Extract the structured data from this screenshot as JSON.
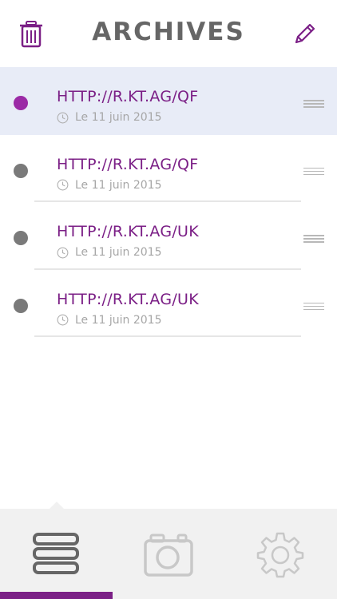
{
  "header": {
    "title": "ARCHIVES",
    "trash_icon": "trash-icon",
    "edit_icon": "pencil-icon"
  },
  "items": [
    {
      "url": "HTTP://R.KT.AG/QF",
      "date": "Le 11 juin 2015",
      "selected": true
    },
    {
      "url": "HTTP://R.KT.AG/QF",
      "date": "Le 11 juin 2015",
      "selected": false
    },
    {
      "url": "HTTP://R.KT.AG/UK",
      "date": "Le 11 juin 2015",
      "selected": false
    },
    {
      "url": "HTTP://R.KT.AG/UK",
      "date": "Le 11 juin 2015",
      "selected": false
    }
  ],
  "tabs": [
    {
      "icon": "list-icon",
      "active": true
    },
    {
      "icon": "camera-icon",
      "active": false
    },
    {
      "icon": "gear-icon",
      "active": false
    }
  ],
  "colors": {
    "accent": "#7b1f86",
    "selected_row_bg": "#e8ecf7",
    "unread_dot": "#9b2aa6",
    "read_dot": "#7a7a7a"
  }
}
